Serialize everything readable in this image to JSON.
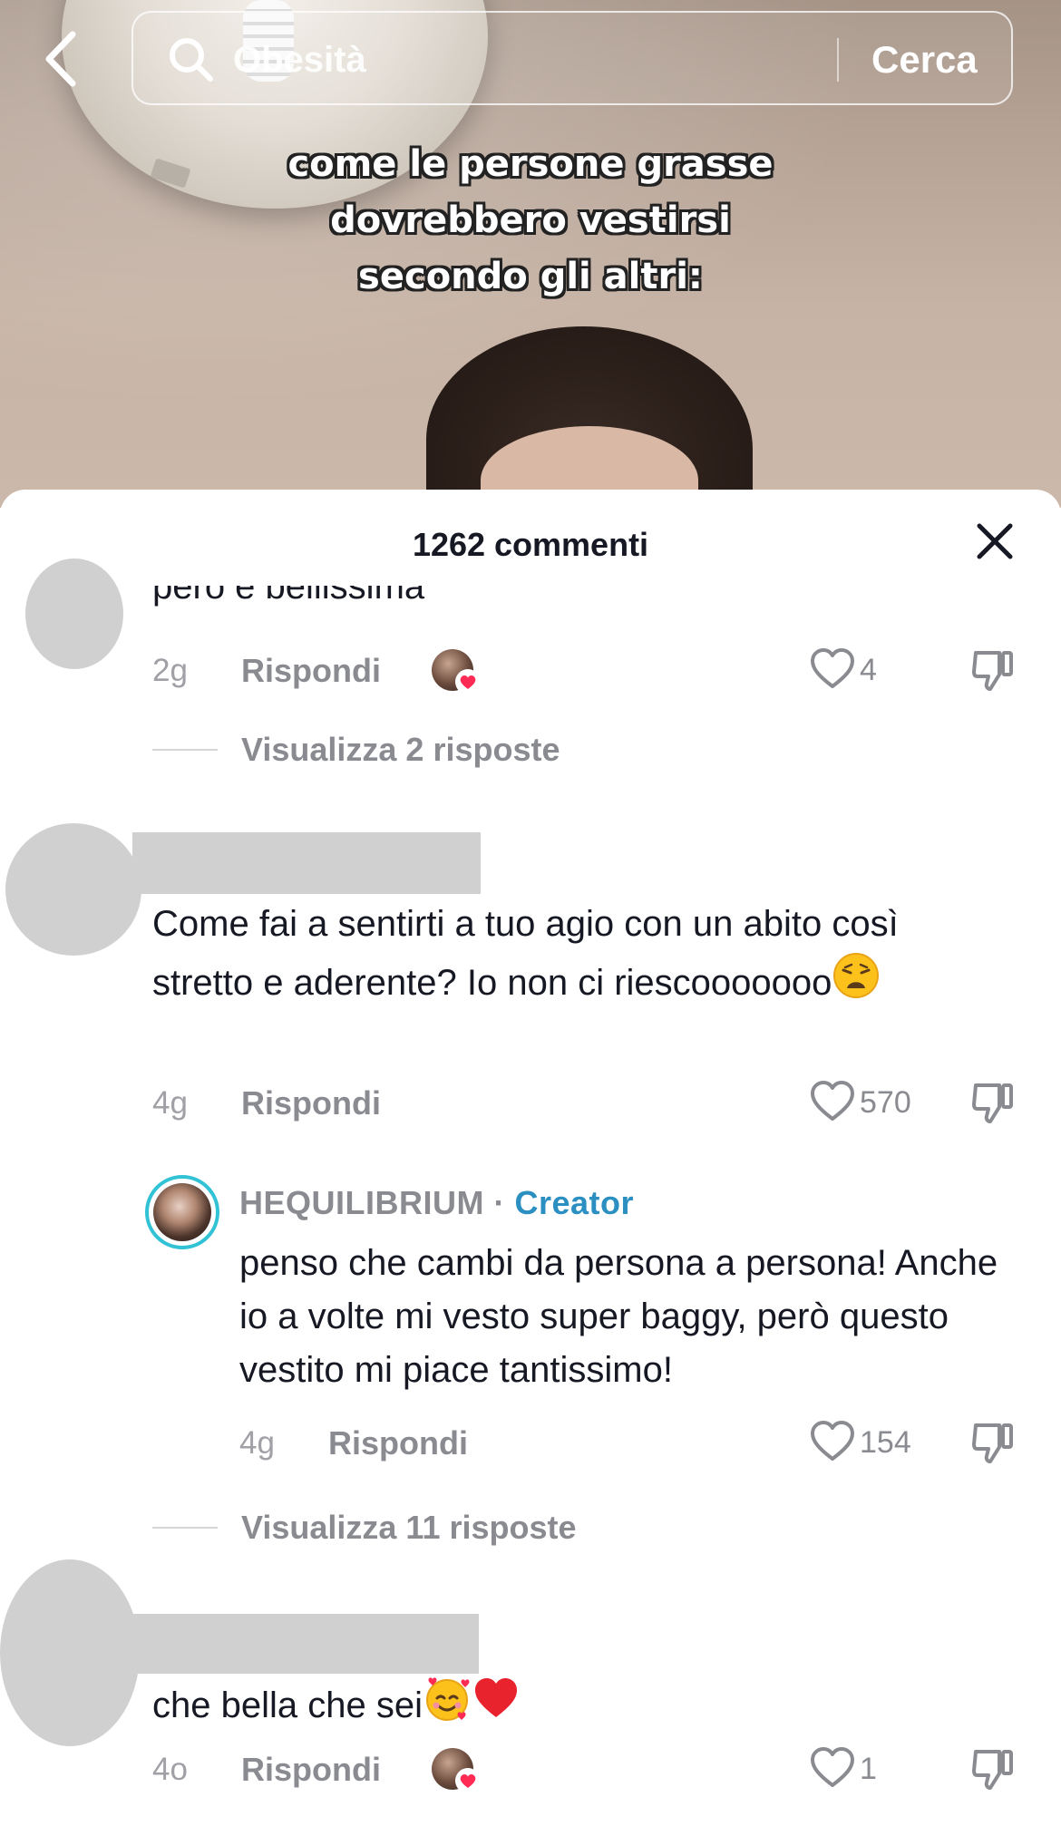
{
  "video": {
    "caption_lines": [
      "come le persone  grasse",
      "dovrebbero vestirsi",
      "secondo gli altri:"
    ]
  },
  "search": {
    "query": "Obesità",
    "submit_label": "Cerca",
    "icons": {
      "back": "chevron-left-icon",
      "search": "search-icon"
    }
  },
  "sheet": {
    "title": "1262 commenti",
    "close_icon": "close-icon"
  },
  "comments": [
    {
      "text": "però è bellissima",
      "time": "2g",
      "reply_label": "Rispondi",
      "likes": "4",
      "creator_liked": true,
      "view_replies": "Visualizza 2 risposte"
    },
    {
      "text": "Come fai a sentirti a tuo agio con un abito così stretto e aderente? Io non ci riescooooooo",
      "emoji": "weary-face",
      "time": "4g",
      "reply_label": "Rispondi",
      "likes": "570"
    },
    {
      "author": "HEQUILIBRIUM",
      "separator": " · ",
      "badge": "Creator",
      "text": "penso che cambi da persona a persona! Anche io a volte mi vesto super baggy, però questo vestito mi piace tantissimo!",
      "time": "4g",
      "reply_label": "Rispondi",
      "likes": "154",
      "view_replies": "Visualizza 11 risposte"
    },
    {
      "text": "che bella che sei",
      "emoji": [
        "smiling-face-with-hearts",
        "red-heart"
      ],
      "time": "4o",
      "reply_label": "Rispondi",
      "likes": "1",
      "creator_liked": true
    }
  ],
  "colors": {
    "creator_badge": "#2b8fc2",
    "creator_ring": "#31c2d5",
    "text_primary": "#161823",
    "text_secondary": "#8a8b91",
    "mini_heart": "#fe2c55"
  }
}
